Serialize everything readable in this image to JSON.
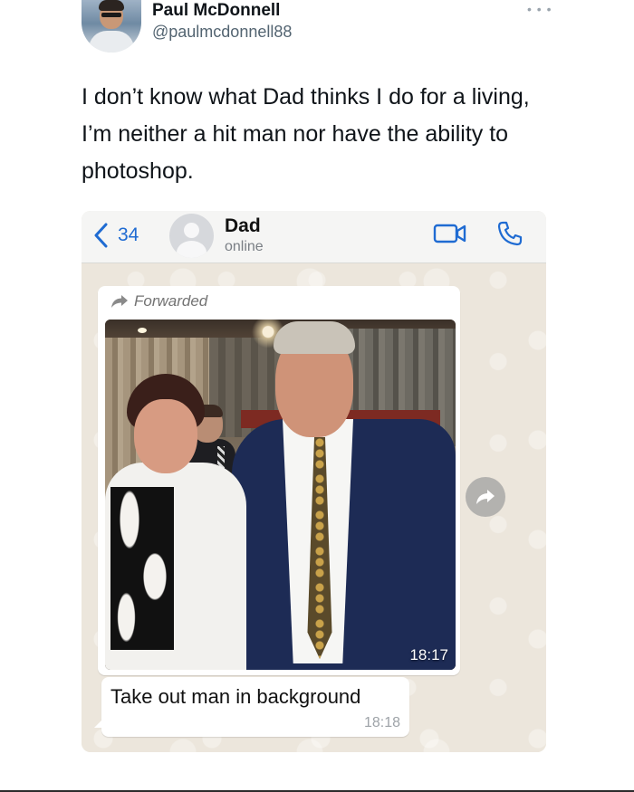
{
  "tweet": {
    "display_name": "Paul McDonnell",
    "handle": "@paulmcdonnell88",
    "more_icon": "more-dots-icon",
    "text": "I don’t know what Dad thinks I do for a living, I’m neither a hit man nor have the ability to photoshop."
  },
  "chat": {
    "back_count": "34",
    "contact_name": "Dad",
    "contact_status": "online",
    "accent_color": "#1f6bd2",
    "icons": [
      "chevron-left-icon",
      "video-call-icon",
      "phone-call-icon",
      "forward-arrow-icon",
      "share-icon"
    ],
    "messages": [
      {
        "type": "image",
        "forwarded_label": "Forwarded",
        "time": "18:17"
      },
      {
        "type": "text",
        "text": "Take out man in background",
        "time": "18:18"
      }
    ]
  }
}
